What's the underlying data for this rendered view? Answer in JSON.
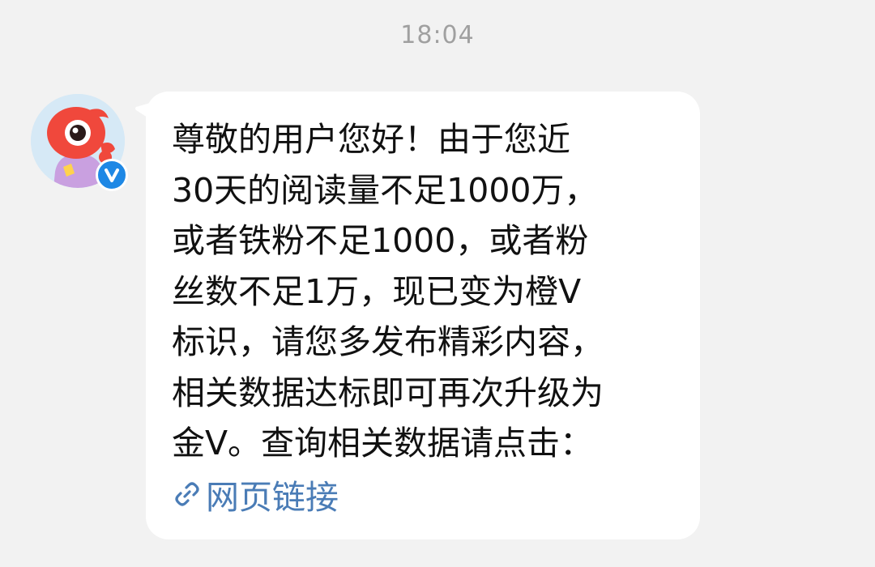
{
  "chat": {
    "timestamp": "18:04",
    "sender": {
      "avatar_icon": "weibo-mascot-icon",
      "badge_icon": "verified-v-icon",
      "badge_color": "#1e88e5"
    },
    "message": {
      "lines": [
        "尊敬的用户您好！由于您近",
        "30天的阅读量不足1000万，",
        "或者铁粉不足1000，或者粉",
        "丝数不足1万，现已变为橙V",
        "标识，请您多发布精彩内容，",
        "相关数据达标即可再次升级为",
        "金V。查询相关数据请点击："
      ],
      "link": {
        "icon": "link-icon",
        "label": "网页链接",
        "color": "#4a7cb6"
      }
    }
  }
}
